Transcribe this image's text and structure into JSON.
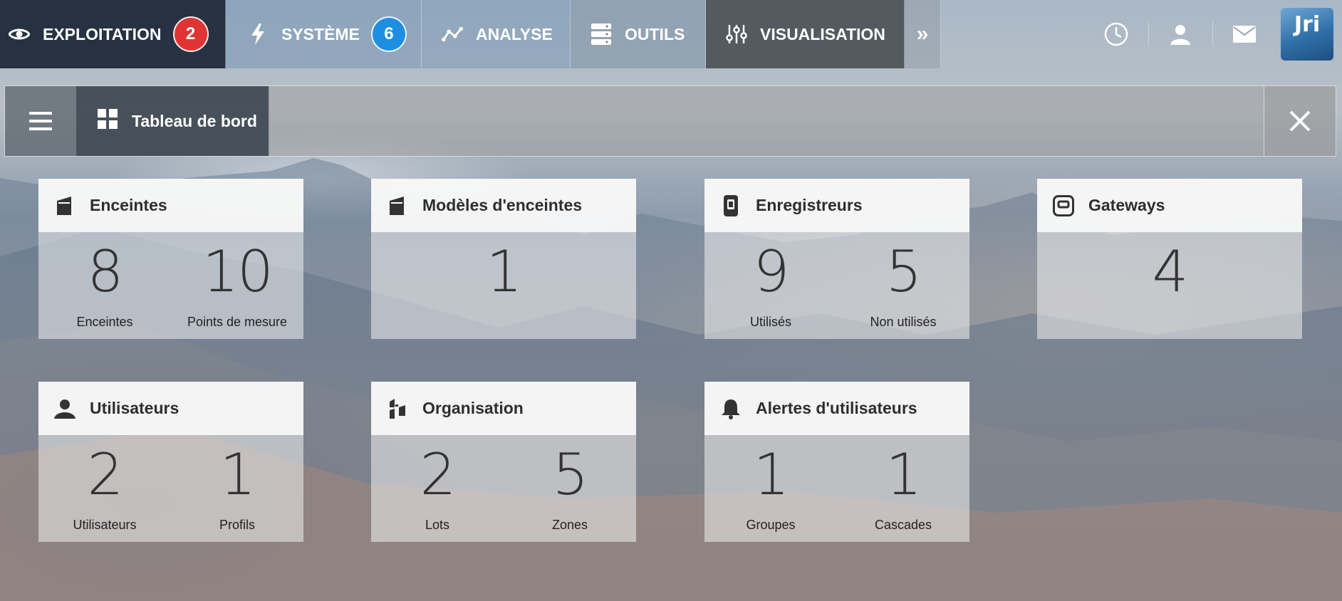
{
  "nav": {
    "tabs": [
      {
        "label": "EXPLOITATION",
        "icon": "eye-icon",
        "badge": "2",
        "badge_color": "#e03434"
      },
      {
        "label": "SYSTÈME",
        "icon": "lightning-icon",
        "badge": "6",
        "badge_color": "#1e8fe0"
      },
      {
        "label": "ANALYSE",
        "icon": "line-chart-icon"
      },
      {
        "label": "OUTILS",
        "icon": "server-icon"
      },
      {
        "label": "VISUALISATION",
        "icon": "sliders-icon"
      }
    ],
    "more_icon": "double-chevron-right-icon",
    "right_icons": [
      "clock-icon",
      "user-icon",
      "mail-icon"
    ],
    "logo_text": "Jri"
  },
  "dashboard": {
    "tab_label": "Tableau de bord",
    "cards": [
      {
        "title": "Enceintes",
        "icon": "enclosure-icon",
        "metrics": [
          {
            "value": "8",
            "label": "Enceintes"
          },
          {
            "value": "10",
            "label": "Points de mesure"
          }
        ]
      },
      {
        "title": "Modèles d'enceintes",
        "icon": "enclosure-model-icon",
        "metrics": [
          {
            "value": "1",
            "label": ""
          }
        ]
      },
      {
        "title": "Enregistreurs",
        "icon": "recorder-icon",
        "metrics": [
          {
            "value": "9",
            "label": "Utilisés"
          },
          {
            "value": "5",
            "label": "Non utilisés"
          }
        ]
      },
      {
        "title": "Gateways",
        "icon": "gateway-icon",
        "metrics": [
          {
            "value": "4",
            "label": ""
          }
        ]
      },
      {
        "title": "Utilisateurs",
        "icon": "user-icon",
        "metrics": [
          {
            "value": "2",
            "label": "Utilisateurs"
          },
          {
            "value": "1",
            "label": "Profils"
          }
        ]
      },
      {
        "title": "Organisation",
        "icon": "organisation-icon",
        "metrics": [
          {
            "value": "2",
            "label": "Lots"
          },
          {
            "value": "5",
            "label": "Zones"
          }
        ]
      },
      {
        "title": "Alertes d'utilisateurs",
        "icon": "bell-icon",
        "metrics": [
          {
            "value": "1",
            "label": "Groupes"
          },
          {
            "value": "1",
            "label": "Cascades"
          }
        ]
      }
    ]
  }
}
